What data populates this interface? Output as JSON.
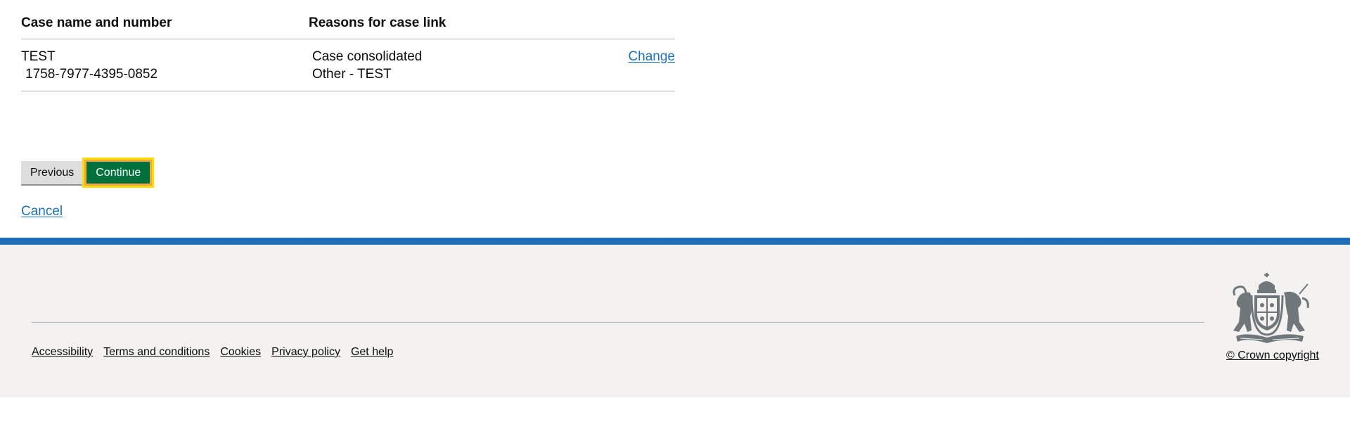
{
  "table": {
    "headers": {
      "case": "Case name and number",
      "reasons": "Reasons for case link"
    },
    "rows": [
      {
        "case_name": "TEST",
        "case_number": "1758-7977-4395-0852",
        "reasons": [
          "Case consolidated",
          "Other - TEST"
        ],
        "action": "Change"
      }
    ]
  },
  "buttons": {
    "previous": "Previous",
    "continue": "Continue"
  },
  "cancel": "Cancel",
  "footer": {
    "links": [
      "Accessibility",
      "Terms and conditions",
      "Cookies",
      "Privacy policy",
      "Get help"
    ],
    "copyright": "© Crown copyright",
    "accent_color": "#1d70b8",
    "background_color": "#f3f2f1",
    "crest_icon": "royal-coat-of-arms-icon"
  },
  "colors": {
    "link": "#1d70b8",
    "continue_button": "#00703c",
    "focus_outline": "#f0a742"
  }
}
